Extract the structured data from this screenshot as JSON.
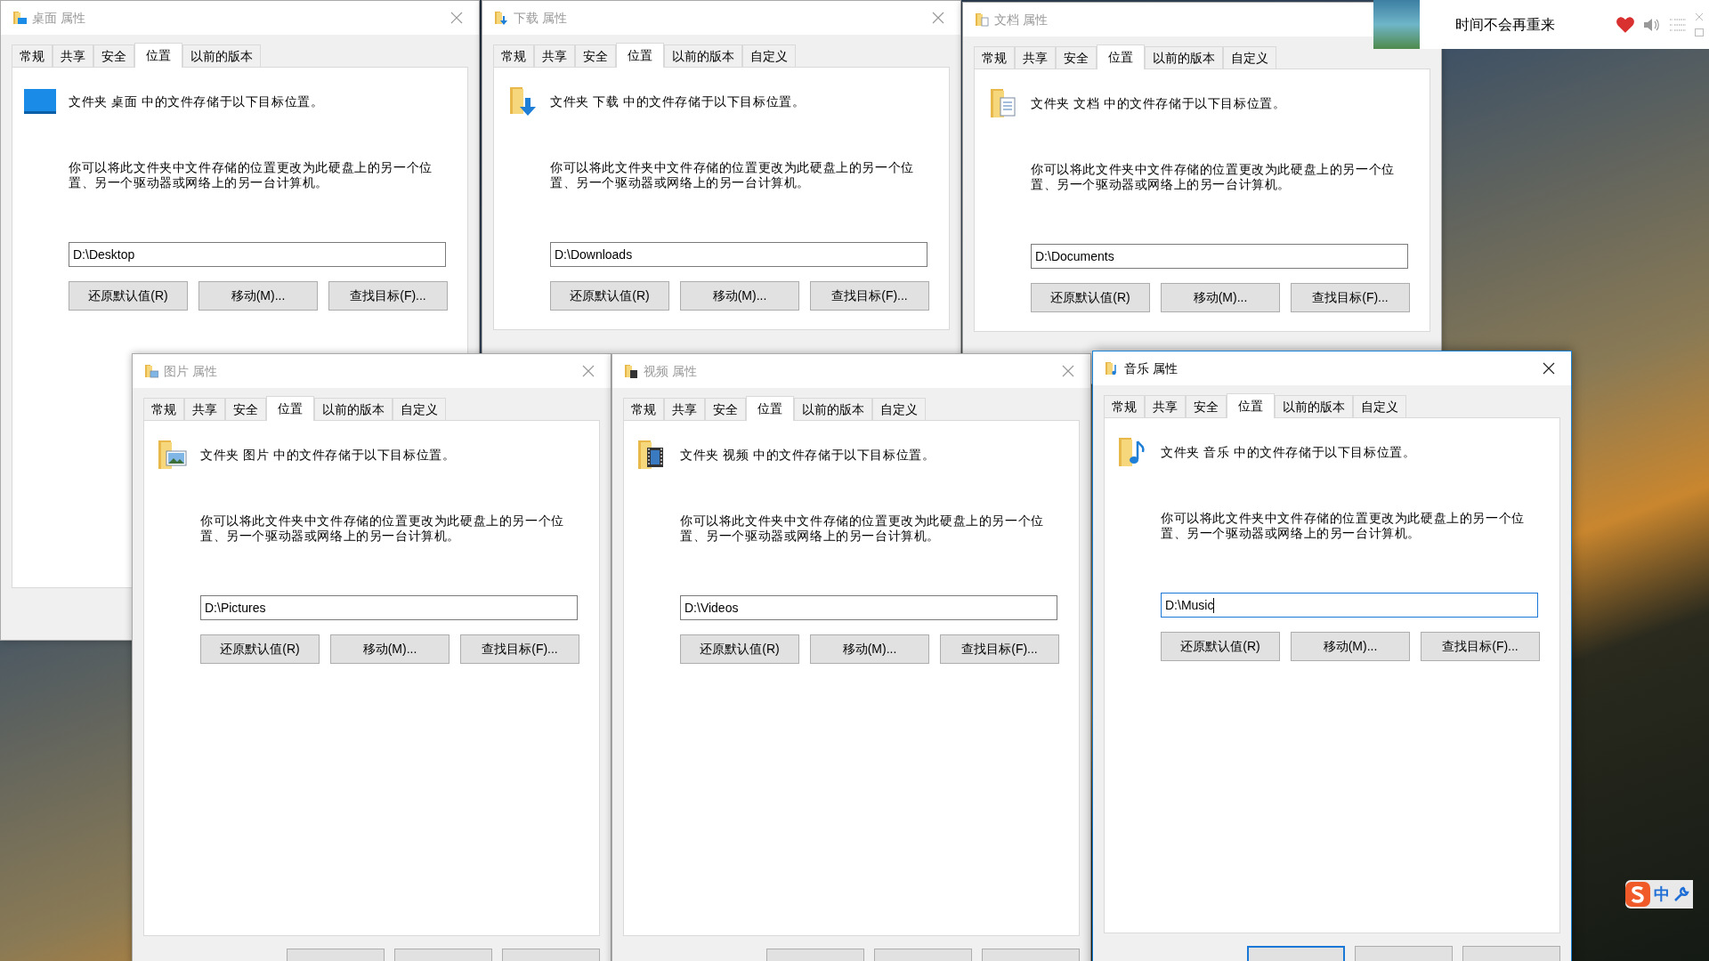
{
  "windows": [
    {
      "title": "桌面 属性",
      "kind": "desktop",
      "active": false,
      "tabs": [
        {
          "label": "常规",
          "selected": false
        },
        {
          "label": "共享",
          "selected": false
        },
        {
          "label": "安全",
          "selected": false
        },
        {
          "label": "位置",
          "selected": true
        },
        {
          "label": "以前的版本",
          "selected": false
        }
      ],
      "description": "文件夹 桌面 中的文件存储于以下目标位置。",
      "info": "你可以将此文件夹中文件存储的位置更改为此硬盘上的另一个位置、另一个驱动器或网络上的另一台计算机。",
      "path": {
        "value": "D:\\Desktop",
        "focused": false
      },
      "buttons": [
        "还原默认值(R)",
        "移动(M)...",
        "查找目标(F)..."
      ]
    },
    {
      "title": "下载 属性",
      "kind": "downloads",
      "active": false,
      "tabs": [
        {
          "label": "常规",
          "selected": false
        },
        {
          "label": "共享",
          "selected": false
        },
        {
          "label": "安全",
          "selected": false
        },
        {
          "label": "位置",
          "selected": true
        },
        {
          "label": "以前的版本",
          "selected": false
        },
        {
          "label": "自定义",
          "selected": false
        }
      ],
      "description": "文件夹 下载 中的文件存储于以下目标位置。",
      "info": "你可以将此文件夹中文件存储的位置更改为此硬盘上的另一个位置、另一个驱动器或网络上的另一台计算机。",
      "path": {
        "value": "D:\\Downloads",
        "focused": false
      },
      "buttons": [
        "还原默认值(R)",
        "移动(M)...",
        "查找目标(F)..."
      ]
    },
    {
      "title": "文档 属性",
      "kind": "documents",
      "active": false,
      "tabs": [
        {
          "label": "常规",
          "selected": false
        },
        {
          "label": "共享",
          "selected": false
        },
        {
          "label": "安全",
          "selected": false
        },
        {
          "label": "位置",
          "selected": true
        },
        {
          "label": "以前的版本",
          "selected": false
        },
        {
          "label": "自定义",
          "selected": false
        }
      ],
      "description": "文件夹 文档 中的文件存储于以下目标位置。",
      "info": "你可以将此文件夹中文件存储的位置更改为此硬盘上的另一个位置、另一个驱动器或网络上的另一台计算机。",
      "path": {
        "value": "D:\\Documents",
        "focused": false
      },
      "buttons": [
        "还原默认值(R)",
        "移动(M)...",
        "查找目标(F)..."
      ]
    },
    {
      "title": "图片 属性",
      "kind": "pictures",
      "active": false,
      "tabs": [
        {
          "label": "常规",
          "selected": false
        },
        {
          "label": "共享",
          "selected": false
        },
        {
          "label": "安全",
          "selected": false
        },
        {
          "label": "位置",
          "selected": true
        },
        {
          "label": "以前的版本",
          "selected": false
        },
        {
          "label": "自定义",
          "selected": false
        }
      ],
      "description": "文件夹 图片 中的文件存储于以下目标位置。",
      "info": "你可以将此文件夹中文件存储的位置更改为此硬盘上的另一个位置、另一个驱动器或网络上的另一台计算机。",
      "path": {
        "value": "D:\\Pictures",
        "focused": false
      },
      "buttons": [
        "还原默认值(R)",
        "移动(M)...",
        "查找目标(F)..."
      ]
    },
    {
      "title": "视频 属性",
      "kind": "videos",
      "active": false,
      "tabs": [
        {
          "label": "常规",
          "selected": false
        },
        {
          "label": "共享",
          "selected": false
        },
        {
          "label": "安全",
          "selected": false
        },
        {
          "label": "位置",
          "selected": true
        },
        {
          "label": "以前的版本",
          "selected": false
        },
        {
          "label": "自定义",
          "selected": false
        }
      ],
      "description": "文件夹 视频 中的文件存储于以下目标位置。",
      "info": "你可以将此文件夹中文件存储的位置更改为此硬盘上的另一个位置、另一个驱动器或网络上的另一台计算机。",
      "path": {
        "value": "D:\\Videos",
        "focused": false
      },
      "buttons": [
        "还原默认值(R)",
        "移动(M)...",
        "查找目标(F)..."
      ]
    },
    {
      "title": "音乐 属性",
      "kind": "music",
      "active": true,
      "tabs": [
        {
          "label": "常规",
          "selected": false
        },
        {
          "label": "共享",
          "selected": false
        },
        {
          "label": "安全",
          "selected": false
        },
        {
          "label": "位置",
          "selected": true
        },
        {
          "label": "以前的版本",
          "selected": false
        },
        {
          "label": "自定义",
          "selected": false
        }
      ],
      "description": "文件夹 音乐 中的文件存储于以下目标位置。",
      "info": "你可以将此文件夹中文件存储的位置更改为此硬盘上的另一个位置、另一个驱动器或网络上的另一台计算机。",
      "path": {
        "value": "D:\\Music",
        "focused": true
      },
      "buttons": [
        "还原默认值(R)",
        "移动(M)...",
        "查找目标(F)..."
      ]
    }
  ],
  "music_player": {
    "song": "时间不会再重来",
    "liked": true
  },
  "ime": {
    "mode": "中"
  }
}
